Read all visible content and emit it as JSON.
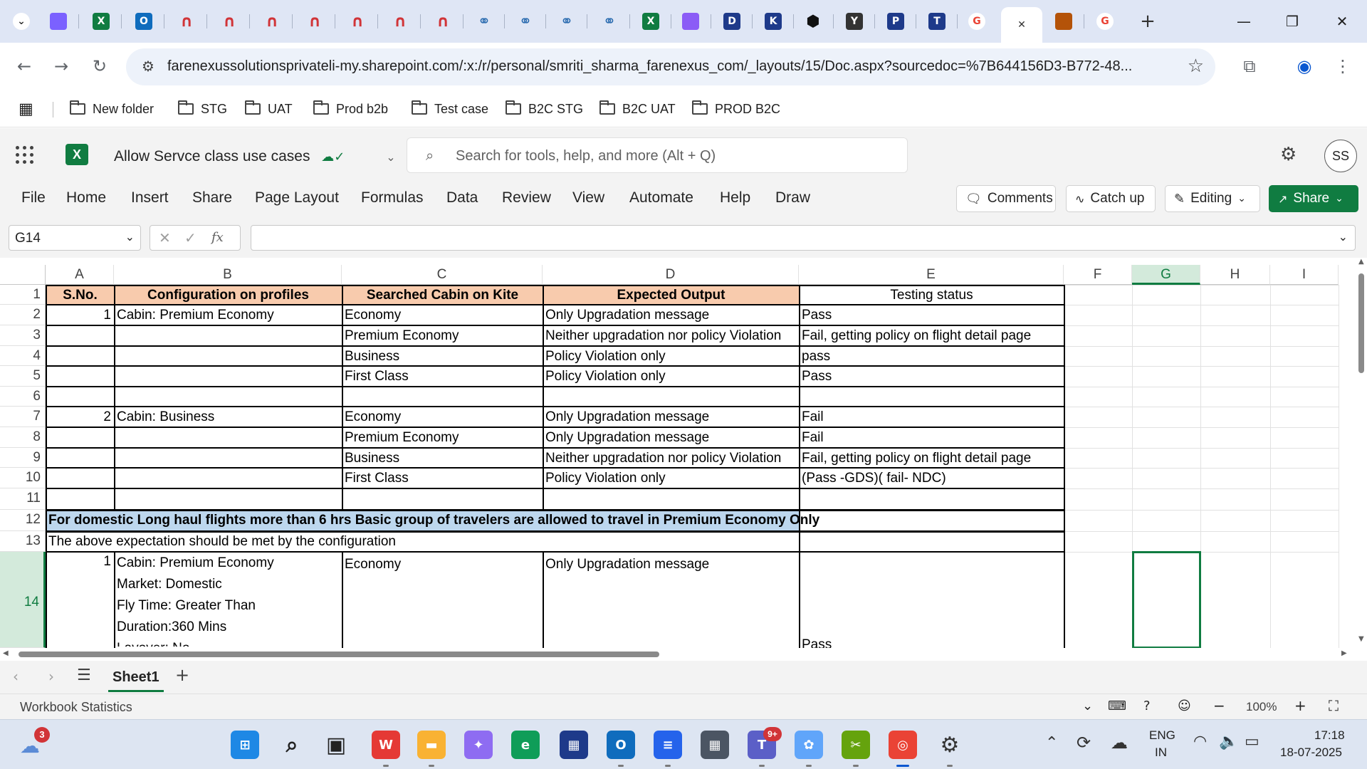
{
  "browser": {
    "tabs": [
      {
        "icon": "chevron-down-icon"
      },
      {
        "icon": "copilot-icon",
        "color": "#7b61ff"
      },
      {
        "icon": "excel-icon",
        "color": "#107c41",
        "glyph": "X"
      },
      {
        "icon": "outlook-icon",
        "color": "#0f6cbd",
        "glyph": "O"
      },
      {
        "icon": "magnet-icon",
        "color": "#d13438"
      },
      {
        "icon": "magnet-icon",
        "color": "#d13438"
      },
      {
        "icon": "magnet-icon",
        "color": "#d13438"
      },
      {
        "icon": "magnet-icon",
        "color": "#d13438"
      },
      {
        "icon": "magnet-icon",
        "color": "#d13438"
      },
      {
        "icon": "magnet-icon",
        "color": "#d13438"
      },
      {
        "icon": "magnet-icon",
        "color": "#d13438"
      },
      {
        "icon": "link-icon",
        "color": "#2b6cb0"
      },
      {
        "icon": "link-icon",
        "color": "#2b6cb0"
      },
      {
        "icon": "link-icon",
        "color": "#2b6cb0"
      },
      {
        "icon": "link-icon",
        "color": "#2b6cb0"
      },
      {
        "icon": "excel-icon",
        "color": "#107c41",
        "glyph": "X"
      },
      {
        "icon": "teams-icon",
        "color": "#8b5cf6"
      },
      {
        "icon": "d-icon",
        "color": "#1e3a8a",
        "glyph": "D"
      },
      {
        "icon": "k-icon",
        "color": "#1e3a8a",
        "glyph": "K"
      },
      {
        "icon": "hexagon-icon",
        "color": "#111111"
      },
      {
        "icon": "y-icon",
        "color": "#333333",
        "glyph": "Y"
      },
      {
        "icon": "p-icon",
        "color": "#1e3a8a",
        "glyph": "P"
      },
      {
        "icon": "t-icon",
        "color": "#1e3a8a",
        "glyph": "T"
      },
      {
        "icon": "google-icon",
        "color": "#ea4335",
        "glyph": "G"
      },
      {
        "icon": "close-icon",
        "active": true
      },
      {
        "icon": "site-icon",
        "color": "#b45309"
      },
      {
        "icon": "google-icon",
        "color": "#ea4335",
        "glyph": "G"
      }
    ],
    "url": "farenexussolutionsprivateli-my.sharepoint.com/:x:/r/personal/smriti_sharma_farenexus_com/_layouts/15/Doc.aspx?sourcedoc=%7B644156D3-B772-48...",
    "bookmarks": [
      "New folder",
      "STG",
      "UAT",
      "Prod b2b",
      "Test case",
      "B2C STG",
      "B2C UAT",
      "PROD B2C"
    ]
  },
  "excel": {
    "doc_title": "Allow Servce class use cases",
    "search_placeholder": "Search for tools, help, and more (Alt + Q)",
    "avatar_initials": "SS",
    "ribbon_tabs": [
      "File",
      "Home",
      "Insert",
      "Share",
      "Page Layout",
      "Formulas",
      "Data",
      "Review",
      "View",
      "Automate",
      "Help",
      "Draw"
    ],
    "buttons": {
      "comments": "Comments",
      "catch_up": "Catch up",
      "editing": "Editing",
      "share": "Share"
    },
    "name_box": "G14",
    "fx_label": "fx",
    "columns": [
      "A",
      "B",
      "C",
      "D",
      "E",
      "F",
      "G",
      "H",
      "I"
    ],
    "selected_column": "G",
    "selected_row": "14",
    "rows": [
      {
        "n": "1",
        "a": "S.No.",
        "b": "Configuration on profiles",
        "c": "Searched Cabin on Kite",
        "d": "Expected Output",
        "e": "Testing status"
      },
      {
        "n": "2",
        "a": "1",
        "b": "Cabin: Premium Economy",
        "c": "Economy",
        "d": "Only Upgradation message",
        "e": "Pass"
      },
      {
        "n": "3",
        "a": "",
        "b": "",
        "c": "Premium Economy",
        "d": "Neither upgradation nor policy Violation",
        "e": "Fail, getting policy on flight detail page"
      },
      {
        "n": "4",
        "a": "",
        "b": "",
        "c": "Business",
        "d": "Policy Violation only",
        "e": "pass"
      },
      {
        "n": "5",
        "a": "",
        "b": "",
        "c": "First Class",
        "d": "Policy Violation only",
        "e": "Pass"
      },
      {
        "n": "6",
        "a": "",
        "b": "",
        "c": "",
        "d": "",
        "e": ""
      },
      {
        "n": "7",
        "a": "2",
        "b": "Cabin: Business",
        "c": "Economy",
        "d": "Only Upgradation message",
        "e": "Fail"
      },
      {
        "n": "8",
        "a": "",
        "b": "",
        "c": "Premium Economy",
        "d": "Only Upgradation message",
        "e": "Fail"
      },
      {
        "n": "9",
        "a": "",
        "b": "",
        "c": "Business",
        "d": "Neither upgradation nor policy Violation",
        "e": "Fail, getting policy on flight detail page"
      },
      {
        "n": "10",
        "a": "",
        "b": "",
        "c": "First Class",
        "d": "Policy Violation only",
        "e": "(Pass -GDS)( fail- NDC)"
      },
      {
        "n": "11",
        "a": "",
        "b": "",
        "c": "",
        "d": "",
        "e": ""
      }
    ],
    "row12": {
      "n": "12",
      "text": "For domestic Long haul flights more than 6 hrs  Basic group of travelers are allowed to travel in Premium Economy Only"
    },
    "row13": {
      "n": "13",
      "text": "The above expectation should be met by the configuration"
    },
    "row14": {
      "n": "14",
      "a": "1",
      "b_lines": [
        "Cabin: Premium Economy",
        "Market: Domestic",
        "Fly Time: Greater Than",
        "Duration:360 Mins",
        "Layover: No"
      ],
      "c": "Economy",
      "d": "Only Upgradation message",
      "e": "Pass"
    },
    "sheet_tab": "Sheet1",
    "status_left": "Workbook Statistics",
    "zoom": "100%"
  },
  "taskbar": {
    "weather_badge": "3",
    "teams_badge": "9+",
    "lang_top": "ENG",
    "lang_bottom": "IN",
    "time": "17:18",
    "date": "18-07-2025"
  },
  "colors": {
    "header_fill": "#f8cbad",
    "band_fill": "#bdd7ee",
    "excel_green": "#107c41"
  }
}
